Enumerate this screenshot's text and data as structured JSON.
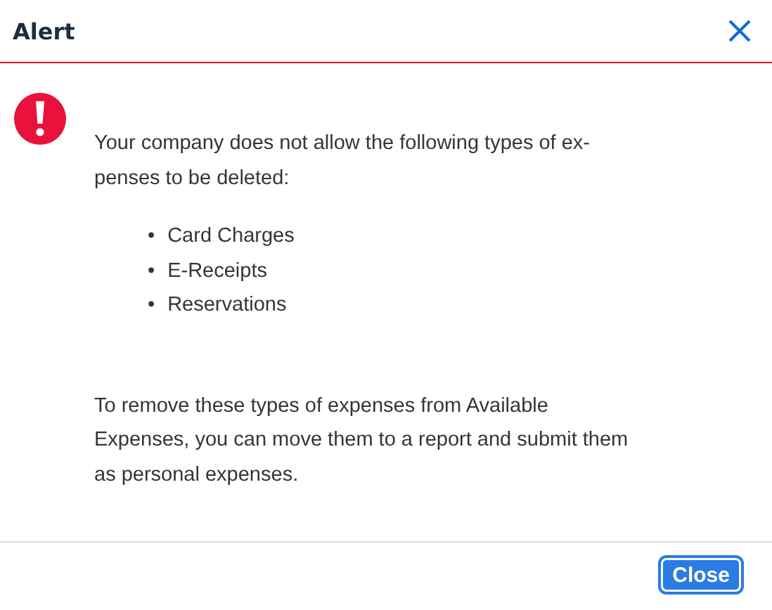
{
  "dialog": {
    "title": "Alert",
    "message_lines": [
      "Your company does not allow the following types of ex-",
      "penses to be deleted:"
    ],
    "items": [
      {
        "marker": "•",
        "text": "Card Charges"
      },
      {
        "marker": "•",
        "text": "E-Receipts"
      },
      {
        "marker": "•",
        "text": "Reservations"
      }
    ],
    "note_lines": [
      "To remove these types of expenses from Available",
      "Expenses, you can move them to a report and submit them",
      "as personal expenses."
    ],
    "buttons": [
      "Close"
    ]
  }
}
